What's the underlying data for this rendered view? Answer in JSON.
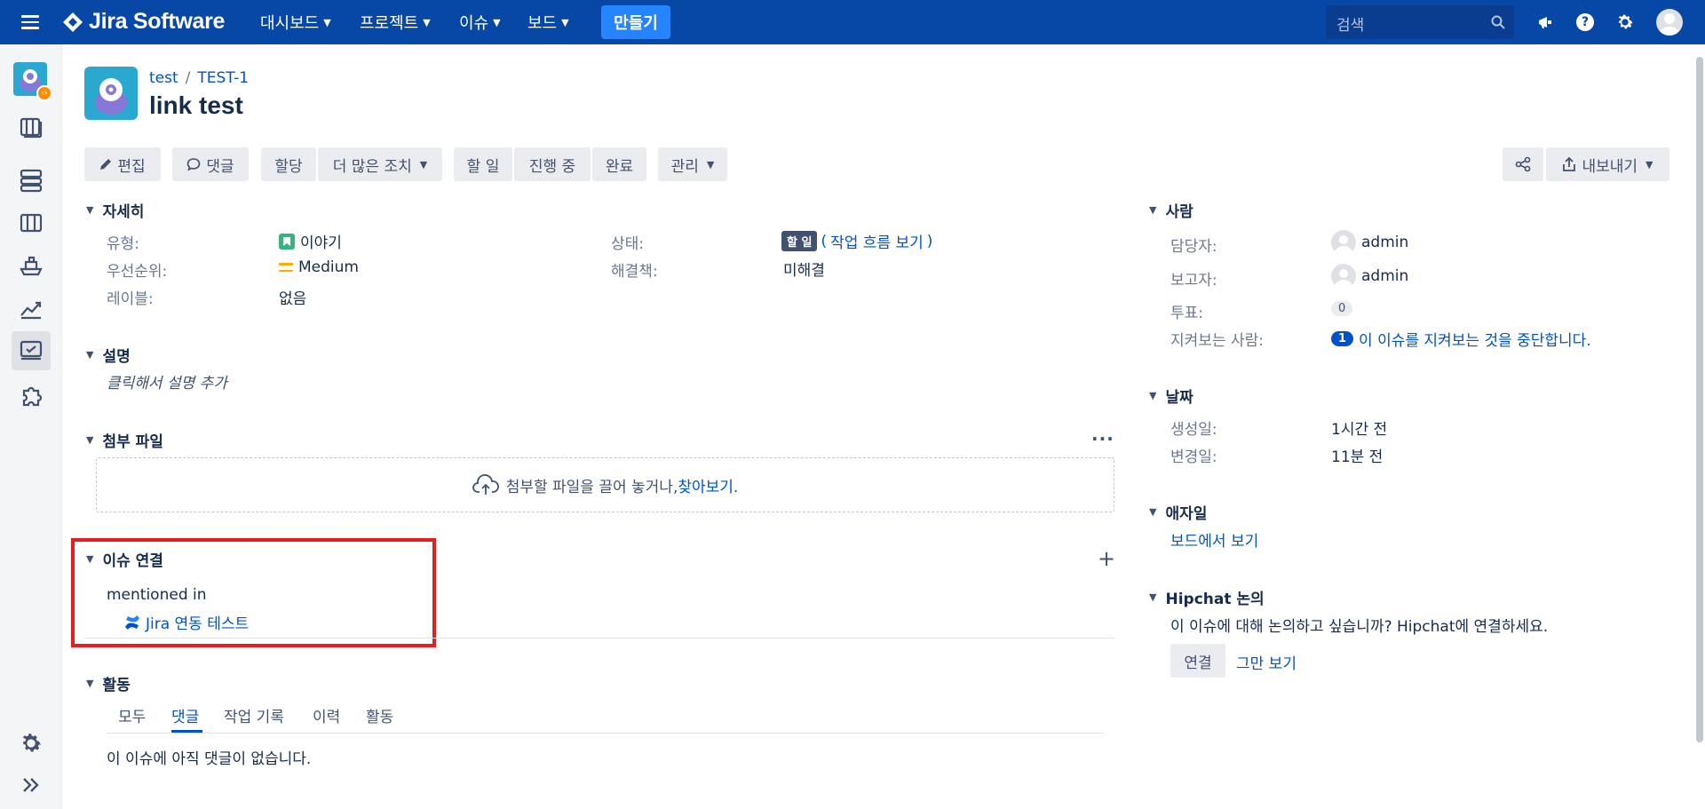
{
  "app": {
    "name": "Jira Software"
  },
  "topnav": {
    "items": [
      "대시보드",
      "프로젝트",
      "이슈",
      "보드"
    ],
    "create": "만들기",
    "search_placeholder": "검색"
  },
  "breadcrumb": {
    "project": "test",
    "issue_key": "TEST-1"
  },
  "issue": {
    "title": "link test"
  },
  "toolbar": {
    "edit": "편집",
    "comment": "댓글",
    "assign": "할당",
    "more": "더 많은 조치",
    "todo": "할 일",
    "in_progress": "진행 중",
    "done": "완료",
    "admin": "관리",
    "export": "내보내기"
  },
  "details": {
    "title": "자세히",
    "type_label": "유형:",
    "type_value": "이야기",
    "priority_label": "우선순위:",
    "priority_value": "Medium",
    "labels_label": "레이블:",
    "labels_value": "없음",
    "status_label": "상태:",
    "status_value": "할 일",
    "workflow_link": "작업 흐름 보기",
    "resolution_label": "해결책:",
    "resolution_value": "미해결"
  },
  "description": {
    "title": "설명",
    "placeholder": "클릭해서 설명 추가"
  },
  "attachments": {
    "title": "첨부 파일",
    "drop_text": "첨부할 파일을 끌어 놓거나, ",
    "browse": "찾아보기."
  },
  "links": {
    "title": "이슈 연결",
    "relation": "mentioned in",
    "page": "Jira 연동 테스트"
  },
  "activity": {
    "title": "활동",
    "tabs": [
      "모두",
      "댓글",
      "작업 기록",
      "이력",
      "활동"
    ],
    "active_tab": "댓글",
    "empty": "이 이슈에 아직 댓글이 없습니다."
  },
  "people": {
    "title": "사람",
    "assignee_label": "담당자:",
    "assignee": "admin",
    "reporter_label": "보고자:",
    "reporter": "admin",
    "votes_label": "투표:",
    "votes": "0",
    "watchers_label": "지켜보는 사람:",
    "watchers": "1",
    "watch_link": "이 이슈를 지켜보는 것을 중단합니다."
  },
  "dates": {
    "title": "날짜",
    "created_label": "생성일:",
    "created": "1시간 전",
    "updated_label": "변경일:",
    "updated": "11분 전"
  },
  "agile": {
    "title": "애자일",
    "link": "보드에서 보기"
  },
  "hipchat": {
    "title": "Hipchat 논의",
    "text": "이 이슈에 대해 논의하고 싶습니까? Hipchat에 연결하세요.",
    "connect": "연결",
    "dismiss": "그만 보기"
  },
  "colors": {
    "topbar": "#0747a6",
    "accent": "#0052cc",
    "create": "#2684ff",
    "highlight": "#e81d1d"
  }
}
